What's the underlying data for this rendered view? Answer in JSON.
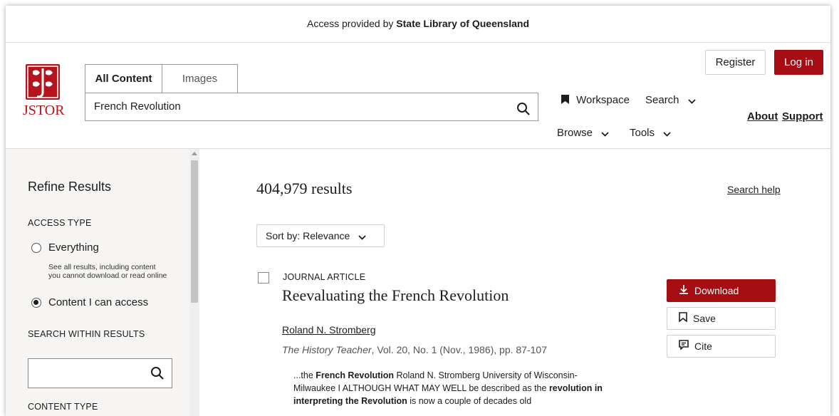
{
  "access_bar": {
    "prefix": "Access provided by",
    "institution": "State Library of Queensland"
  },
  "header": {
    "logo_text": "JSTOR",
    "tabs": [
      {
        "label": "All Content"
      },
      {
        "label": "Images"
      }
    ],
    "search": {
      "value": "French Revolution"
    },
    "nav": {
      "workspace": "Workspace",
      "search": "Search",
      "browse": "Browse",
      "tools": "Tools",
      "about": "About",
      "support": "Support"
    },
    "register": "Register",
    "login": "Log in"
  },
  "sidebar": {
    "title": "Refine Results",
    "access_type_label": "ACCESS TYPE",
    "options": [
      {
        "label": "Everything",
        "desc": "See all results, including content you cannot download or read online",
        "checked": false
      },
      {
        "label": "Content I can access",
        "checked": true
      }
    ],
    "search_within_label": "SEARCH WITHIN RESULTS",
    "search_within_value": "",
    "content_type_label": "CONTENT TYPE"
  },
  "results": {
    "count": "404,979 results",
    "search_help": "Search help",
    "sort_label": "Sort by: Relevance",
    "items": [
      {
        "type": "JOURNAL ARTICLE",
        "title": "Reevaluating the French Revolution",
        "author": "Roland N. Stromberg",
        "journal": "The History Teacher",
        "citation_rest": ", Vol. 20, No. 1 (Nov., 1986), pp. 87-107",
        "snippet": {
          "part1": "...the ",
          "bold1": "French Revolution",
          "part2": " Roland N. Stromberg University of Wisconsin-Milwaukee I ALTHOUGH WHAT MAY WELL be described as the ",
          "bold2": "revolution in interpreting the Revolution",
          "part3": " is now a couple of decades old"
        },
        "actions": {
          "download": "Download",
          "save": "Save",
          "cite": "Cite"
        }
      }
    ]
  },
  "colors": {
    "brand_red": "#a50d12",
    "sidebar_bg": "#f6f5f3"
  }
}
